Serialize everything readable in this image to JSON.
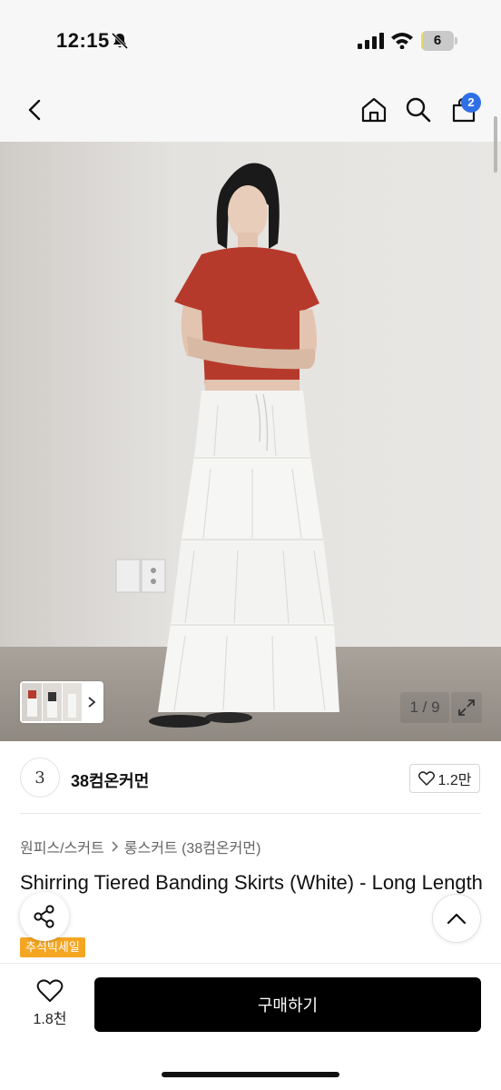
{
  "status_bar": {
    "time": "12:15",
    "battery_level": "6",
    "battery_fraction": 0.06,
    "icons": [
      "bell-off-icon",
      "signal-icon",
      "wifi-icon",
      "battery-icon"
    ]
  },
  "header": {
    "icons": [
      "back-arrow-icon",
      "home-icon",
      "search-icon",
      "cart-icon"
    ],
    "cart_count": "2"
  },
  "gallery": {
    "counter": "1 / 9",
    "current_index": 1,
    "total": 9
  },
  "brand": {
    "logo_text": "3",
    "name": "38컴온커먼",
    "like_count": "1.2만"
  },
  "product": {
    "breadcrumb": [
      "원피스/스커트",
      "롱스커트 (38컴온커먼)"
    ],
    "title": "Shirring Tiered Banding Skirts (White) - Long Length",
    "badge": "추석빅세일"
  },
  "bottom_bar": {
    "wish_count": "1.8천",
    "buy_label": "구매하기"
  },
  "colors": {
    "cart_badge": "#2f6fe6",
    "sale_badge": "#f4a623",
    "buy_button": "#000000"
  }
}
